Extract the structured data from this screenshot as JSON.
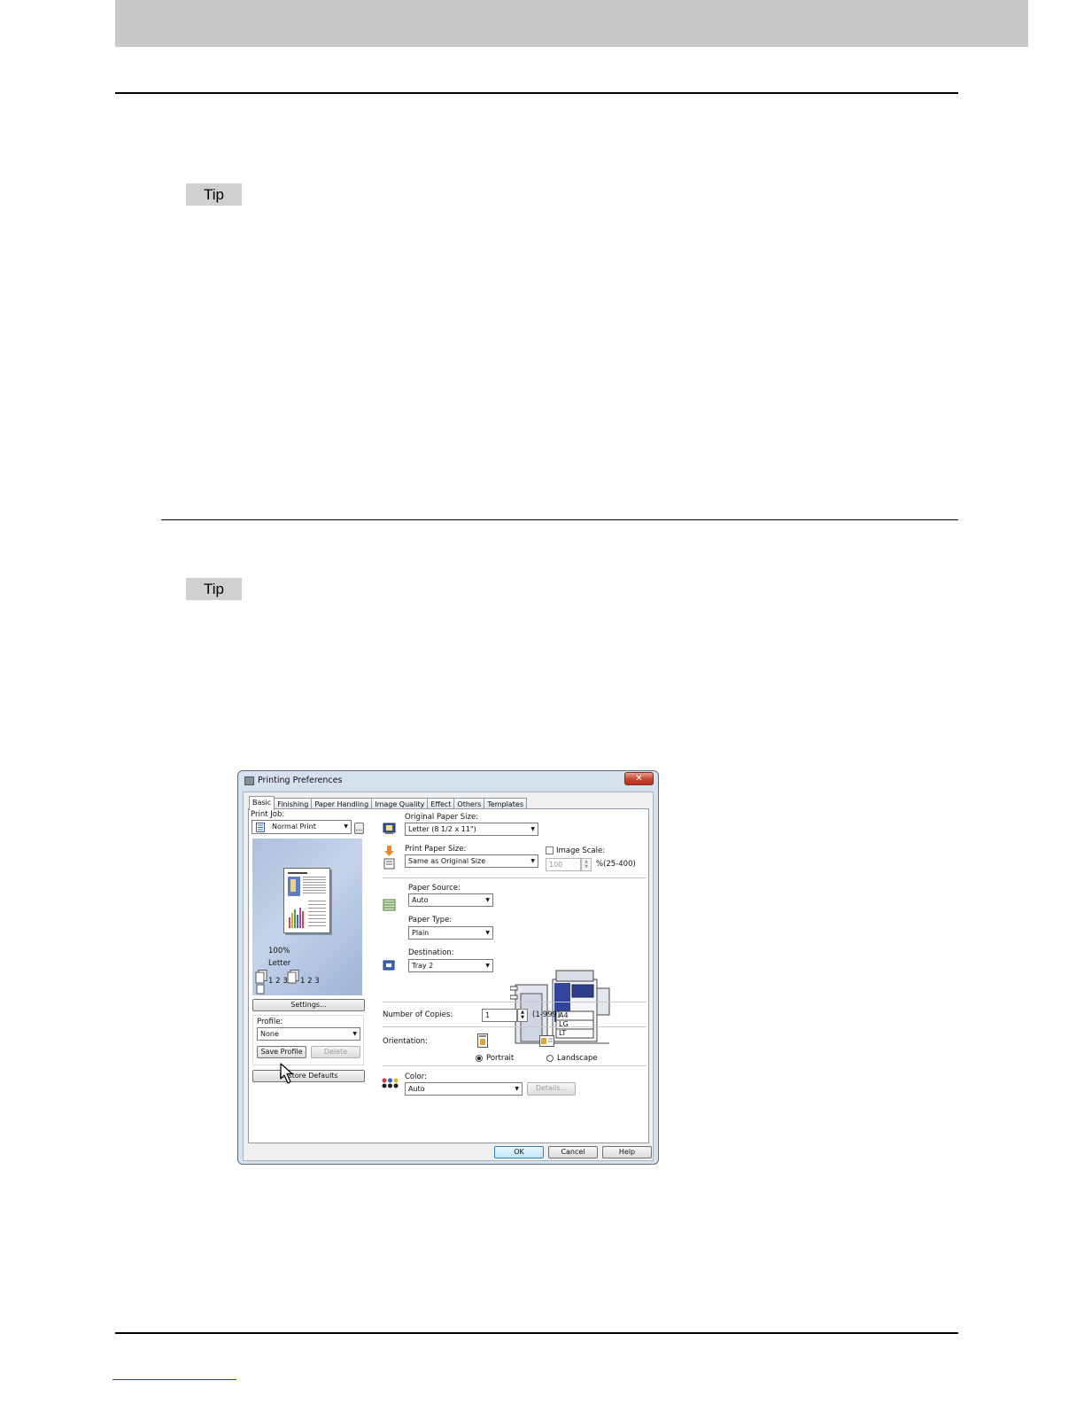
{
  "tips": [
    "Tip",
    "Tip"
  ],
  "dialog": {
    "title": "Printing Preferences",
    "close_icon": "close-icon",
    "tabs": [
      "Basic",
      "Finishing",
      "Paper Handling",
      "Image Quality",
      "Effect",
      "Others",
      "Templates"
    ],
    "print_job": {
      "label": "Print Job:",
      "value": "Normal Print",
      "more_button": "..."
    },
    "preview": {
      "zoom": "100%",
      "paper": "Letter",
      "collate_a": "1 2 3",
      "collate_b": "1 2 3"
    },
    "settings_button": "Settings...",
    "profile": {
      "label": "Profile:",
      "value": "None",
      "save_button": "Save Profile",
      "delete_button": "Delete"
    },
    "restore_button": "Restore Defaults",
    "original_paper_size": {
      "label": "Original Paper Size:",
      "value": "Letter (8 1/2 x 11\")"
    },
    "print_paper_size": {
      "label": "Print Paper Size:",
      "value": "Same as Original Size"
    },
    "image_scale": {
      "label": "Image Scale:",
      "value": "100",
      "range": "%(25-400)"
    },
    "paper_source": {
      "label": "Paper Source:",
      "value": "Auto"
    },
    "paper_type": {
      "label": "Paper Type:",
      "value": "Plain"
    },
    "destination": {
      "label": "Destination:",
      "value": "Tray 2"
    },
    "machine_labels": [
      "A4",
      "LG",
      "LT"
    ],
    "copies": {
      "label": "Number of Copies:",
      "value": "1",
      "range": "(1-999)"
    },
    "orientation": {
      "label": "Orientation:",
      "portrait": "Portrait",
      "landscape": "Landscape"
    },
    "color": {
      "label": "Color:",
      "value": "Auto",
      "details_button": "Details..."
    },
    "buttons": {
      "ok": "OK",
      "cancel": "Cancel",
      "help": "Help"
    }
  }
}
